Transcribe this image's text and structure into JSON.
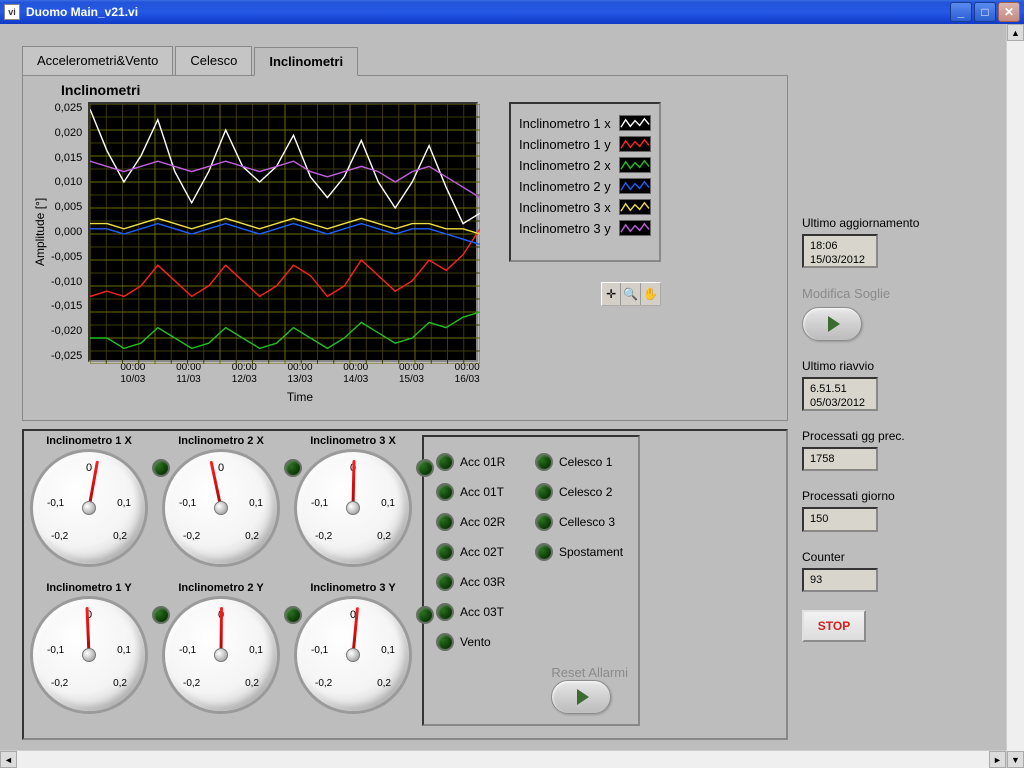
{
  "window": {
    "title": "Duomo Main_v21.vi"
  },
  "tabs": [
    "Accelerometri&Vento",
    "Celesco",
    "Inclinometri"
  ],
  "active_tab": 2,
  "chart_data": {
    "type": "line",
    "title": "Inclinometri",
    "xlabel": "Time",
    "ylabel": "Amplitude [°]",
    "ylim": [
      -0.025,
      0.025
    ],
    "yticks": [
      "0,025",
      "0,020",
      "0,015",
      "0,010",
      "0,005",
      "0,000",
      "-0,005",
      "-0,010",
      "-0,015",
      "-0,020",
      "-0,025"
    ],
    "xticks": [
      {
        "t": "00:00",
        "d": "10/03"
      },
      {
        "t": "00:00",
        "d": "11/03"
      },
      {
        "t": "00:00",
        "d": "12/03"
      },
      {
        "t": "00:00",
        "d": "13/03"
      },
      {
        "t": "00:00",
        "d": "14/03"
      },
      {
        "t": "00:00",
        "d": "15/03"
      },
      {
        "t": "00:00",
        "d": "16/03"
      }
    ],
    "series": [
      {
        "name": "Inclinometro 1 x",
        "color": "#ffffff",
        "values": [
          0.024,
          0.016,
          0.01,
          0.015,
          0.022,
          0.012,
          0.006,
          0.012,
          0.02,
          0.013,
          0.01,
          0.013,
          0.019,
          0.011,
          0.007,
          0.011,
          0.018,
          0.01,
          0.005,
          0.01,
          0.017,
          0.009,
          0.002,
          0.004
        ]
      },
      {
        "name": "Inclinometro 1 y",
        "color": "#ff2020",
        "values": [
          -0.012,
          -0.011,
          -0.012,
          -0.01,
          -0.006,
          -0.009,
          -0.012,
          -0.01,
          -0.006,
          -0.009,
          -0.012,
          -0.01,
          -0.006,
          -0.008,
          -0.012,
          -0.01,
          -0.005,
          -0.008,
          -0.011,
          -0.009,
          -0.005,
          -0.007,
          -0.004,
          0.001
        ]
      },
      {
        "name": "Inclinometro 2 x",
        "color": "#20c020",
        "values": [
          -0.02,
          -0.02,
          -0.022,
          -0.021,
          -0.018,
          -0.02,
          -0.022,
          -0.021,
          -0.018,
          -0.02,
          -0.022,
          -0.021,
          -0.018,
          -0.02,
          -0.022,
          -0.02,
          -0.017,
          -0.019,
          -0.021,
          -0.02,
          -0.017,
          -0.018,
          -0.016,
          -0.015
        ]
      },
      {
        "name": "Inclinometro 2 y",
        "color": "#2060ff",
        "values": [
          0.001,
          0.001,
          0.0,
          0.001,
          0.002,
          0.001,
          0.0,
          0.001,
          0.002,
          0.001,
          0.0,
          0.001,
          0.002,
          0.001,
          0.0,
          0.001,
          0.002,
          0.001,
          0.0,
          0.001,
          0.001,
          0.0,
          -0.001,
          -0.002
        ]
      },
      {
        "name": "Inclinometro 3 x",
        "color": "#f0e040",
        "values": [
          0.002,
          0.002,
          0.001,
          0.002,
          0.003,
          0.002,
          0.001,
          0.002,
          0.003,
          0.002,
          0.001,
          0.002,
          0.003,
          0.002,
          0.001,
          0.002,
          0.003,
          0.002,
          0.001,
          0.002,
          0.002,
          0.001,
          0.001,
          0.0
        ]
      },
      {
        "name": "Inclinometro 3 y",
        "color": "#c060e0",
        "values": [
          0.014,
          0.013,
          0.012,
          0.013,
          0.014,
          0.013,
          0.012,
          0.013,
          0.014,
          0.013,
          0.012,
          0.013,
          0.014,
          0.012,
          0.011,
          0.012,
          0.013,
          0.012,
          0.01,
          0.012,
          0.013,
          0.011,
          0.009,
          0.007
        ]
      }
    ]
  },
  "gauges": [
    {
      "title": "Inclinometro 1 X",
      "value": 0.017,
      "ticks": {
        "n01": "-0,1",
        "p01": "0,1",
        "n02": "-0,2",
        "p02": "0,2",
        "zero": "0"
      }
    },
    {
      "title": "Inclinometro 2 X",
      "value": -0.02,
      "ticks": {
        "n01": "-0,1",
        "p01": "0,1",
        "n02": "-0,2",
        "p02": "0,2",
        "zero": "0"
      }
    },
    {
      "title": "Inclinometro 3 X",
      "value": 0.002,
      "ticks": {
        "n01": "-0,1",
        "p01": "0,1",
        "n02": "-0,2",
        "p02": "0,2",
        "zero": "0"
      }
    },
    {
      "title": "Inclinometro 1 Y",
      "value": -0.004,
      "ticks": {
        "n01": "-0,1",
        "p01": "0,1",
        "n02": "-0,2",
        "p02": "0,2",
        "zero": "0"
      }
    },
    {
      "title": "Inclinometro 2 Y",
      "value": 0.001,
      "ticks": {
        "n01": "-0,1",
        "p01": "0,1",
        "n02": "-0,2",
        "p02": "0,2",
        "zero": "0"
      }
    },
    {
      "title": "Inclinometro 3 Y",
      "value": 0.009,
      "ticks": {
        "n01": "-0,1",
        "p01": "0,1",
        "n02": "-0,2",
        "p02": "0,2",
        "zero": "0"
      }
    }
  ],
  "status_leds_left": [
    "Acc 01R",
    "Acc 01T",
    "Acc 02R",
    "Acc 02T",
    "Acc 03R",
    "Acc 03T",
    "Vento"
  ],
  "status_leds_right": [
    "Celesco 1",
    "Celesco 2",
    "Cellesco 3",
    "Spostament"
  ],
  "reset_label": "Reset Allarmi",
  "right": {
    "last_update_label": "Ultimo aggiornamento",
    "last_update_time": "18:06",
    "last_update_date": "15/03/2012",
    "modify_thresholds": "Modifica Soglie",
    "last_restart_label": "Ultimo riavvio",
    "last_restart_time": "6.51.51",
    "last_restart_date": "05/03/2012",
    "proc_prev_label": "Processati gg prec.",
    "proc_prev_value": "1758",
    "proc_day_label": "Processati giorno",
    "proc_day_value": "150",
    "counter_label": "Counter",
    "counter_value": "93",
    "stop_label": "STOP"
  }
}
